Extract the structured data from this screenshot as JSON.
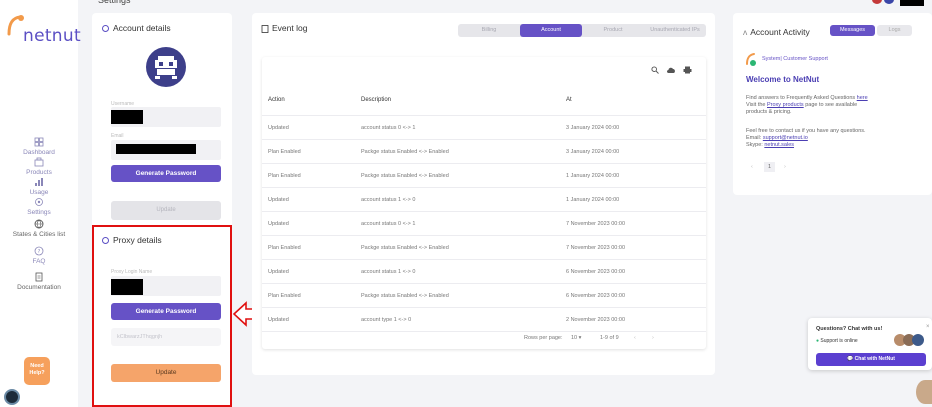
{
  "brand": {
    "name": "netnut"
  },
  "nav": [
    {
      "label": "Dashboard",
      "icon": "dashboard-icon"
    },
    {
      "label": "Products",
      "icon": "products-icon"
    },
    {
      "label": "Usage",
      "icon": "usage-icon"
    },
    {
      "label": "Settings",
      "icon": "settings-icon"
    },
    {
      "label": "States & Cities list",
      "icon": "globe-icon"
    },
    {
      "label": "FAQ",
      "icon": "faq-icon"
    },
    {
      "label": "Documentation",
      "icon": "document-icon"
    }
  ],
  "need_help": {
    "line1": "Need",
    "line2": "Help?"
  },
  "account": {
    "title": "Account details",
    "username_label": "Username",
    "email_label": "Email",
    "generate_password": "Generate Password",
    "update": "Update"
  },
  "proxy": {
    "title": "Proxy details",
    "login_label": "Proxy Login Name",
    "generate_password": "Generate Password",
    "password_placeholder": "kClbwarzJThqgnjh",
    "update": "Update"
  },
  "event_log": {
    "title": "Event log",
    "tabs": [
      "Billing",
      "Account",
      "Product",
      "Unauthenticated IPs"
    ],
    "active_tab": "Account",
    "columns": [
      "Action",
      "Description",
      "At"
    ],
    "rows": [
      {
        "action": "Updated",
        "description": "account status 0 <-> 1",
        "at": "3 January 2024 00:00"
      },
      {
        "action": "Plan Enabled",
        "description": "Packge status Enabled <-> Enabled",
        "at": "3 January 2024 00:00"
      },
      {
        "action": "Plan Enabled",
        "description": "Packge status Enabled <-> Enabled",
        "at": "1 January 2024 00:00"
      },
      {
        "action": "Updated",
        "description": "account status 1 <-> 0",
        "at": "1 January 2024 00:00"
      },
      {
        "action": "Updated",
        "description": "account status 0 <-> 1",
        "at": "7 November 2023 00:00"
      },
      {
        "action": "Plan Enabled",
        "description": "Packge status Enabled <-> Enabled",
        "at": "7 November 2023 00:00"
      },
      {
        "action": "Updated",
        "description": "account status 1 <-> 0",
        "at": "6 November 2023 00:00"
      },
      {
        "action": "Plan Enabled",
        "description": "Packge status Enabled <-> Enabled",
        "at": "6 November 2023 00:00"
      },
      {
        "action": "Updated",
        "description": "account type 1 <-> 0",
        "at": "2 November 2023 00:00"
      }
    ],
    "rows_per_page_label": "Rows per page:",
    "rows_per_page": "10",
    "range": "1-9 of 9"
  },
  "activity": {
    "title": "Account Activity",
    "tabs": [
      "Messages",
      "Logs"
    ],
    "active_tab": "Messages",
    "sender": "System| Customer Support",
    "welcome": "Welcome to NetNut",
    "line1_pre": "Find answers to Frequently Asked Questions ",
    "line1_link": "here",
    "line2_pre": "Visit the ",
    "line2_link": "Proxy products",
    "line2_post": " page to see available",
    "line3": "products & pricing.",
    "line4": "Feel free to contact us if you have any questions.",
    "email_label": "Email: ",
    "email": "support@netnut.io",
    "skype_label": "Skype: ",
    "skype": "netnut.sales",
    "page": "1"
  },
  "chat": {
    "question": "Questions? Chat with us!",
    "status": "Support is online",
    "button": "Chat with NetNut"
  },
  "colors": {
    "accent": "#6652c6",
    "orange": "#f5a46a",
    "highlight": "#e01010"
  }
}
